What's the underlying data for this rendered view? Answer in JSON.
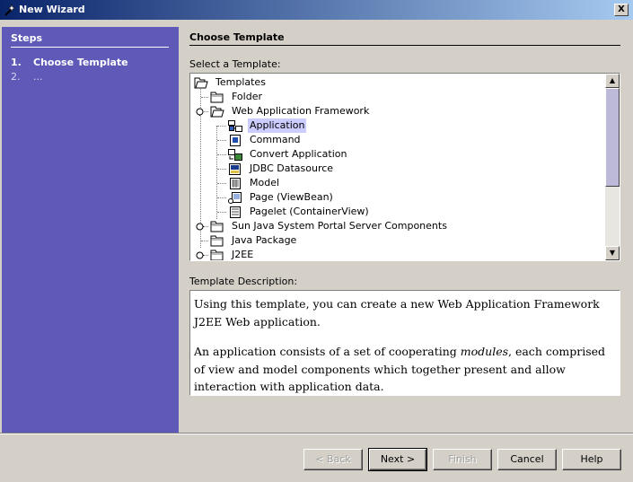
{
  "window": {
    "title": "New Wizard",
    "close_label": "X"
  },
  "steps": {
    "heading": "Steps",
    "items": [
      {
        "num": "1.",
        "label": "Choose Template"
      },
      {
        "num": "2.",
        "label": "..."
      }
    ]
  },
  "main": {
    "title": "Choose Template",
    "select_label": "Select a Template:",
    "description_label": "Template Description:"
  },
  "tree": {
    "items": [
      {
        "label": "Templates",
        "icon": "folder-open-icon",
        "level": 0
      },
      {
        "label": "Folder",
        "icon": "folder-icon",
        "level": 1
      },
      {
        "label": "Web Application Framework",
        "icon": "folder-open-icon",
        "level": 1,
        "expanded": true
      },
      {
        "label": "Application",
        "icon": "application-icon",
        "level": 2,
        "selected": true
      },
      {
        "label": "Command",
        "icon": "command-icon",
        "level": 2
      },
      {
        "label": "Convert Application",
        "icon": "convert-icon",
        "level": 2
      },
      {
        "label": "JDBC Datasource",
        "icon": "datasource-icon",
        "level": 2
      },
      {
        "label": "Model",
        "icon": "model-icon",
        "level": 2
      },
      {
        "label": "Page (ViewBean)",
        "icon": "page-icon",
        "level": 2
      },
      {
        "label": "Pagelet (ContainerView)",
        "icon": "pagelet-icon",
        "level": 2
      },
      {
        "label": "Sun Java System Portal Server Components",
        "icon": "folder-icon",
        "level": 1,
        "collapsed": true
      },
      {
        "label": "Java Package",
        "icon": "folder-icon",
        "level": 1
      },
      {
        "label": "J2EE",
        "icon": "folder-icon",
        "level": 1,
        "collapsed": true
      }
    ]
  },
  "description": {
    "p1": "Using this template, you can create a new Web Application Framework J2EE Web application.",
    "p2_a": "An application consists of a set of cooperating ",
    "p2_em": "modules",
    "p2_b": ", each comprised of view and model components which together present and allow interaction with application data."
  },
  "buttons": {
    "back": "< Back",
    "next": "Next >",
    "finish": "Finish",
    "cancel": "Cancel",
    "help": "Help"
  },
  "colors": {
    "steps_bg": "#5f5ab8",
    "selection": "#ccccff",
    "window_bg": "#d4d0c8"
  }
}
